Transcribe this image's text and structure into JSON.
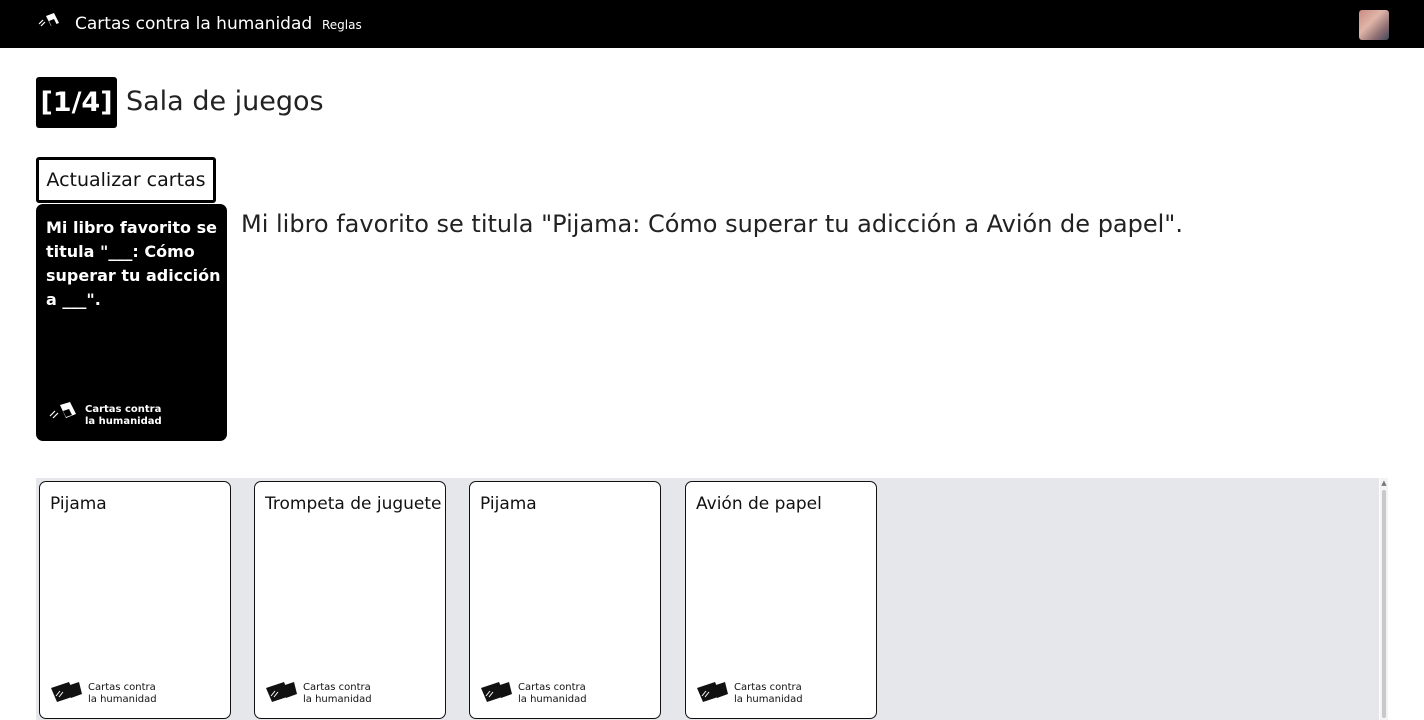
{
  "navbar": {
    "logo_icon": "cards-logo-icon",
    "title": "Cartas contra la humanidad",
    "rules_link": "Reglas",
    "avatar_icon": "user-avatar"
  },
  "header": {
    "round": "[1/4]",
    "title": "Sala de juegos"
  },
  "refresh_button": "Actualizar cartas",
  "black_card": {
    "text": "Mi libro favorito se titula \"___: Cómo superar tu adicción a ___\".",
    "brand_line1": "Cartas contra",
    "brand_line2": "la humanidad"
  },
  "answer_sentence": "Mi libro favorito se titula \"Pijama: Cómo superar tu adicción a Avión de papel\".",
  "hand": {
    "cards": [
      {
        "text": "Pijama",
        "brand_line1": "Cartas contra",
        "brand_line2": "la humanidad"
      },
      {
        "text": "Trompeta de juguete",
        "brand_line1": "Cartas contra",
        "brand_line2": "la humanidad"
      },
      {
        "text": "Pijama",
        "brand_line1": "Cartas contra",
        "brand_line2": "la humanidad"
      },
      {
        "text": "Avión de papel",
        "brand_line1": "Cartas contra",
        "brand_line2": "la humanidad"
      }
    ]
  },
  "colors": {
    "navbar_bg": "#000000",
    "hand_bg": "#e5e7eb",
    "black_card_bg": "#000000",
    "white_card_bg": "#ffffff"
  }
}
